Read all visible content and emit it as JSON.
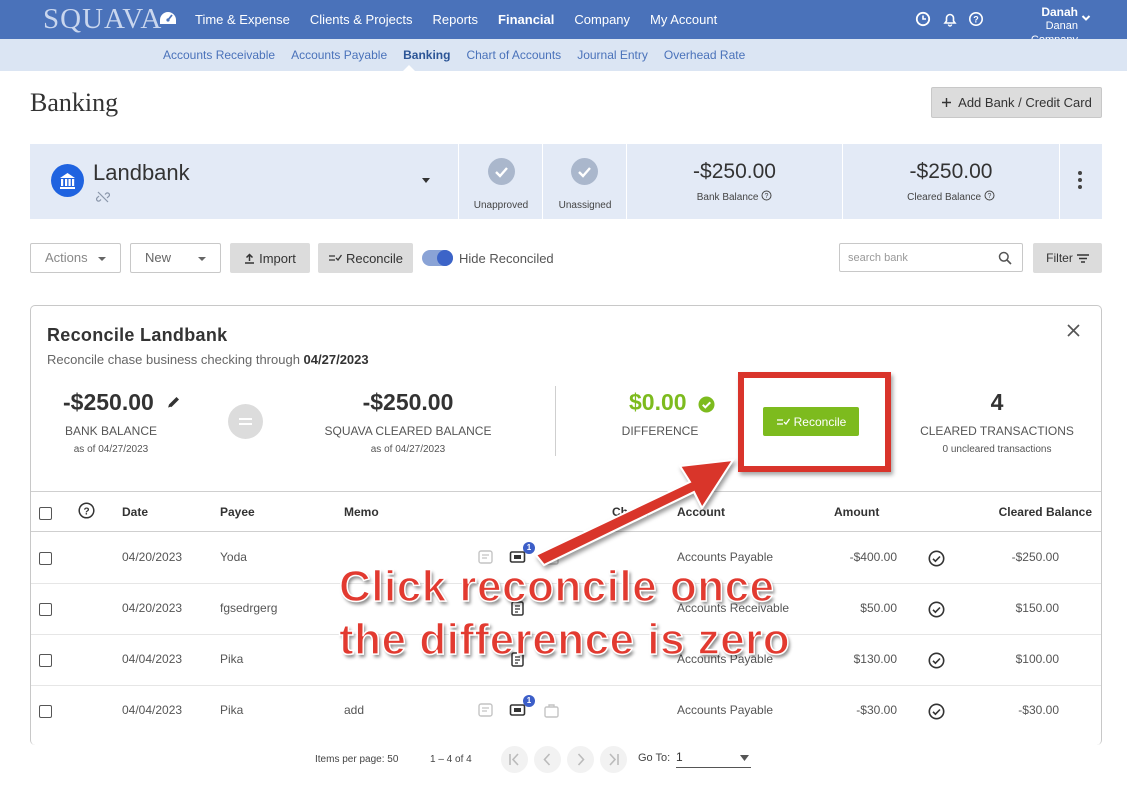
{
  "nav": {
    "logo": "SQUAVA",
    "items": [
      {
        "label": "Time & Expense",
        "active": false
      },
      {
        "label": "Clients & Projects",
        "active": false
      },
      {
        "label": "Reports",
        "active": false
      },
      {
        "label": "Financial",
        "active": true
      },
      {
        "label": "Company",
        "active": false
      },
      {
        "label": "My Account",
        "active": false
      }
    ],
    "user_name": "Danah",
    "user_company": "Danan Company",
    "icons": [
      "dashboard-icon",
      "clock-icon",
      "bell-icon",
      "help-icon",
      "chevron-down-icon"
    ]
  },
  "subnav": {
    "items": [
      {
        "label": "Accounts Receivable",
        "active": false
      },
      {
        "label": "Accounts Payable",
        "active": false
      },
      {
        "label": "Banking",
        "active": true
      },
      {
        "label": "Chart of Accounts",
        "active": false
      },
      {
        "label": "Journal Entry",
        "active": false
      },
      {
        "label": "Overhead Rate",
        "active": false
      }
    ]
  },
  "page": {
    "title": "Banking",
    "add_bank_label": "Add Bank / Credit Card"
  },
  "account": {
    "name": "Landbank",
    "unapproved_label": "Unapproved",
    "unassigned_label": "Unassigned",
    "bank_balance": "-$250.00",
    "bank_balance_label": "Bank Balance",
    "cleared_balance": "-$250.00",
    "cleared_balance_label": "Cleared Balance"
  },
  "toolbar": {
    "actions_label": "Actions",
    "new_label": "New",
    "import_label": "Import",
    "reconcile_label": "Reconcile",
    "hide_reconciled_label": "Hide Reconciled",
    "hide_reconciled_on": true,
    "search_placeholder": "search bank",
    "filter_label": "Filter"
  },
  "reconcile": {
    "title": "Reconcile Landbank",
    "subtitle_prefix": "Reconcile chase business checking through ",
    "through_date": "04/27/2023",
    "bank_balance": "-$250.00",
    "bank_balance_label": "BANK BALANCE",
    "bank_balance_asof": "as of 04/27/2023",
    "cleared_balance": "-$250.00",
    "cleared_balance_label": "SQUAVA CLEARED BALANCE",
    "cleared_balance_asof": "as of 04/27/2023",
    "difference": "$0.00",
    "difference_label": "DIFFERENCE",
    "button_label": "Reconcile",
    "cleared_count": "4",
    "cleared_count_label": "CLEARED TRANSACTIONS",
    "uncleared_note": "0 uncleared transactions",
    "colors": {
      "accent_green": "#7dbb1e",
      "annotation_red": "#d9342b"
    }
  },
  "table": {
    "headers": {
      "date": "Date",
      "payee": "Payee",
      "memo": "Memo",
      "check": "Check",
      "account": "Account",
      "amount": "Amount",
      "cleared_balance": "Cleared Balance"
    },
    "rows": [
      {
        "date": "04/20/2023",
        "payee": "Yoda",
        "memo": "",
        "account": "Accounts Payable",
        "amount": "-$400.00",
        "balance": "-$250.00",
        "badge": "1"
      },
      {
        "date": "04/20/2023",
        "payee": "fgsedrgerg",
        "memo": "",
        "account": "Accounts Receivable",
        "amount": "$50.00",
        "balance": "$150.00",
        "badge": ""
      },
      {
        "date": "04/04/2023",
        "payee": "Pika",
        "memo": "",
        "account": "Accounts Payable",
        "amount": "$130.00",
        "balance": "$100.00",
        "badge": ""
      },
      {
        "date": "04/04/2023",
        "payee": "Pika",
        "memo": "add",
        "account": "Accounts Payable",
        "amount": "-$30.00",
        "balance": "-$30.00",
        "badge": "1"
      }
    ]
  },
  "pagination": {
    "items_per_page_label": "Items per page:",
    "items_per_page": "50",
    "range": "1 – 4 of 4",
    "goto_label": "Go To:",
    "goto_value": "1"
  },
  "annotation": {
    "line1": "Click reconcile once",
    "line2": "the difference is zero"
  }
}
